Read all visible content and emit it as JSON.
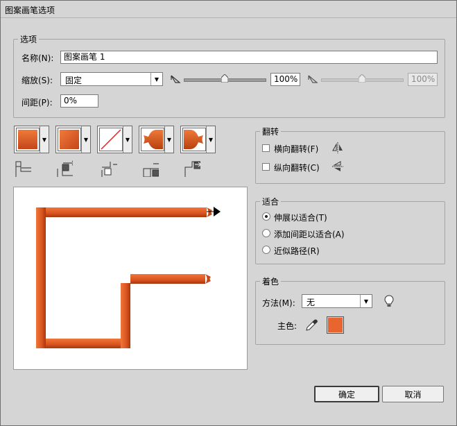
{
  "window": {
    "title": "图案画笔选项"
  },
  "options": {
    "legend": "选项",
    "name_label": "名称(N):",
    "name_value": "图案画笔 1",
    "scale_label": "缩放(S):",
    "scale_value": "固定",
    "scale_percent_1": "100%",
    "scale_percent_2": "100%",
    "spacing_label": "间距(P):",
    "spacing_value": "0%"
  },
  "tiles": [
    {
      "name": "side-tile",
      "icon": "side-tile-icon"
    },
    {
      "name": "outer-corner-tile",
      "icon": "outer-corner-tile-icon"
    },
    {
      "name": "inner-corner-tile",
      "icon": "inner-corner-tile-icon"
    },
    {
      "name": "start-tile",
      "icon": "start-tile-icon"
    },
    {
      "name": "end-tile",
      "icon": "end-tile-icon"
    }
  ],
  "flip": {
    "legend": "翻转",
    "horizontal_label": "横向翻转(F)",
    "vertical_label": "纵向翻转(C)",
    "horizontal_checked": false,
    "vertical_checked": false
  },
  "fit": {
    "legend": "适合",
    "options": [
      "伸展以适合(T)",
      "添加间距以适合(A)",
      "近似路径(R)"
    ],
    "selected": 0
  },
  "colorization": {
    "legend": "着色",
    "method_label": "方法(M):",
    "method_value": "无",
    "key_color_label": "主色:",
    "key_color": "#e8652f"
  },
  "buttons": {
    "ok": "确定",
    "cancel": "取消"
  },
  "colors": {
    "brush": "#e05a22",
    "brush_dark": "#b23c10",
    "window_bg": "#d5d5d5"
  }
}
